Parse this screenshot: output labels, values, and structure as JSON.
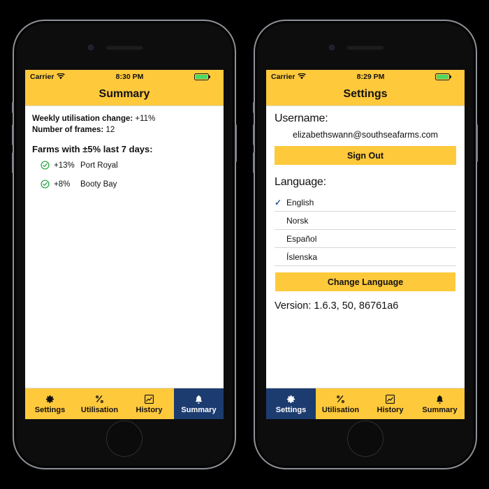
{
  "phones": [
    {
      "id": "summary-phone",
      "status_bar": {
        "carrier": "Carrier",
        "wifi_icon": "wifi-icon",
        "time": "8:30 PM",
        "battery_icon": "battery-icon",
        "charging_icon": "lightning-bolt-icon"
      },
      "nav_title": "Summary",
      "summary": {
        "weekly_label": "Weekly utilisation change:",
        "weekly_value": "+11%",
        "frames_label": "Number of frames:",
        "frames_value": "12",
        "farms_heading": "Farms with ±5% last 7 days:",
        "farms": [
          {
            "icon": "check-circle-icon",
            "percent": "+13%",
            "name": "Port Royal"
          },
          {
            "icon": "check-circle-icon",
            "percent": "+8%",
            "name": "Booty Bay"
          }
        ]
      },
      "tabs": [
        {
          "label": "Settings",
          "icon": "gear-icon",
          "active": false
        },
        {
          "label": "Utilisation",
          "icon": "percent-icon",
          "active": false
        },
        {
          "label": "History",
          "icon": "chart-line-icon",
          "active": false
        },
        {
          "label": "Summary",
          "icon": "bell-icon",
          "active": true
        }
      ]
    },
    {
      "id": "settings-phone",
      "status_bar": {
        "carrier": "Carrier",
        "wifi_icon": "wifi-icon",
        "time": "8:29 PM",
        "battery_icon": "battery-icon",
        "charging_icon": "lightning-bolt-icon"
      },
      "nav_title": "Settings",
      "settings": {
        "username_label": "Username:",
        "username_value": "elizabethswann@southseafarms.com",
        "sign_out_label": "Sign Out",
        "language_label": "Language:",
        "languages": [
          {
            "label": "English",
            "selected": true,
            "tick": "✓"
          },
          {
            "label": "Norsk",
            "selected": false,
            "tick": ""
          },
          {
            "label": "Español",
            "selected": false,
            "tick": ""
          },
          {
            "label": "Íslenska",
            "selected": false,
            "tick": ""
          }
        ],
        "change_language_label": "Change Language",
        "version": "Version: 1.6.3, 50, 86761a6"
      },
      "tabs": [
        {
          "label": "Settings",
          "icon": "gear-icon",
          "active": true
        },
        {
          "label": "Utilisation",
          "icon": "percent-icon",
          "active": false
        },
        {
          "label": "History",
          "icon": "chart-line-icon",
          "active": false
        },
        {
          "label": "Summary",
          "icon": "bell-icon",
          "active": false
        }
      ]
    }
  ],
  "colors": {
    "brand_yellow": "#ffc93c",
    "active_navy": "#1c3c70",
    "check_green": "#23a03a",
    "tick_blue": "#2e5296",
    "battery_green": "#4cd964"
  }
}
